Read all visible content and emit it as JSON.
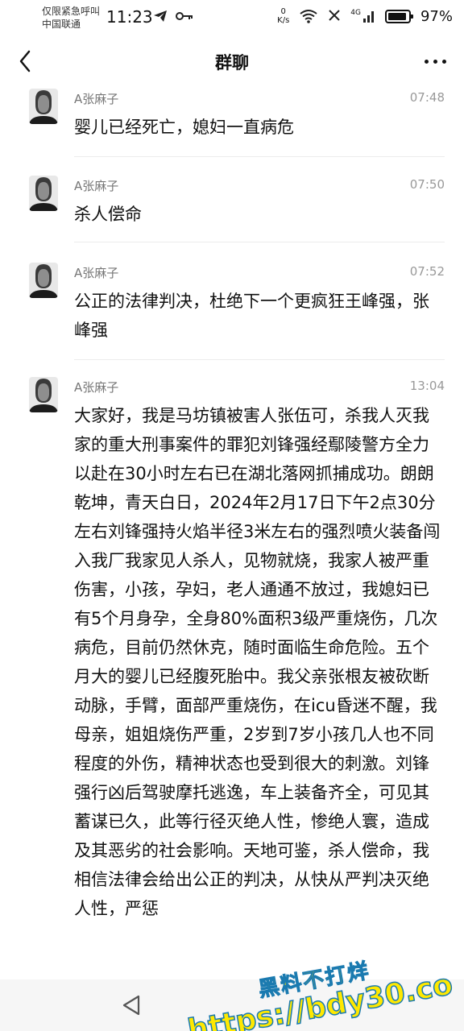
{
  "status_bar": {
    "carrier_line1": "仅限紧急呼叫",
    "carrier_line2": "中国联通",
    "time": "11:23",
    "net_speed_value": "0",
    "net_speed_unit": "K/s",
    "signal_label": "4G",
    "battery": "97%"
  },
  "header": {
    "title": "群聊"
  },
  "messages": [
    {
      "sender": "A张麻子",
      "time": "07:48",
      "text": "婴儿已经死亡，媳妇一直病危"
    },
    {
      "sender": "A张麻子",
      "time": "07:50",
      "text": "杀人偿命"
    },
    {
      "sender": "A张麻子",
      "time": "07:52",
      "text": "公正的法律判决，杜绝下一个更疯狂王峰强，张峰强"
    },
    {
      "sender": "A张麻子",
      "time": "13:04",
      "text": "大家好，我是马坊镇被害人张伍可，杀我人灭我家的重大刑事案件的罪犯刘锋强经鄢陵警方全力以赴在30小时左右已在湖北落网抓捕成功。朗朗乾坤，青天白日，2024年2月17日下午2点30分左右刘锋强持火焰半径3米左右的强烈喷火装备闯入我厂我家见人杀人，见物就烧，我家人被严重伤害，小孩，孕妇，老人通通不放过，我媳妇已有5个月身孕，全身80%面积3级严重烧伤，几次病危，目前仍然休克，随时面临生命危险。五个月大的婴儿已经腹死胎中。我父亲张根友被砍断动脉，手臂，面部严重烧伤，在icu昏迷不醒，我母亲，姐姐烧伤严重，2岁到7岁小孩几人也不同程度的外伤，精神状态也受到很大的刺激。刘锋强行凶后驾驶摩托逃逸，车上装备齐全，可见其蓄谋已久，此等行径灭绝人性，惨绝人寰，造成及其恶劣的社会影响。天地可鉴，杀人偿命，我相信法律会给出公正的判决，从快从严判决灭绝人性，严惩"
    }
  ],
  "watermark": {
    "line1": "黑料不打烊",
    "line2": "https://bdy30.co"
  },
  "icons": {
    "back": "chevron-left-icon",
    "more": "more-dots-icon",
    "avatar": "avatar-photo",
    "nav_back": "triangle-back-icon"
  }
}
